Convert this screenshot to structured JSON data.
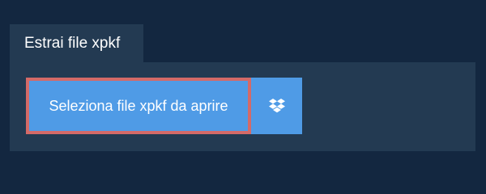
{
  "tab": {
    "label": "Estrai file xpkf"
  },
  "actions": {
    "select_label": "Seleziona file xpkf da aprire",
    "dropbox_icon": "dropbox-icon"
  },
  "colors": {
    "background": "#132740",
    "panel": "#233a52",
    "button": "#4f9be6",
    "highlight_border": "#d46a68",
    "text": "#ffffff"
  }
}
